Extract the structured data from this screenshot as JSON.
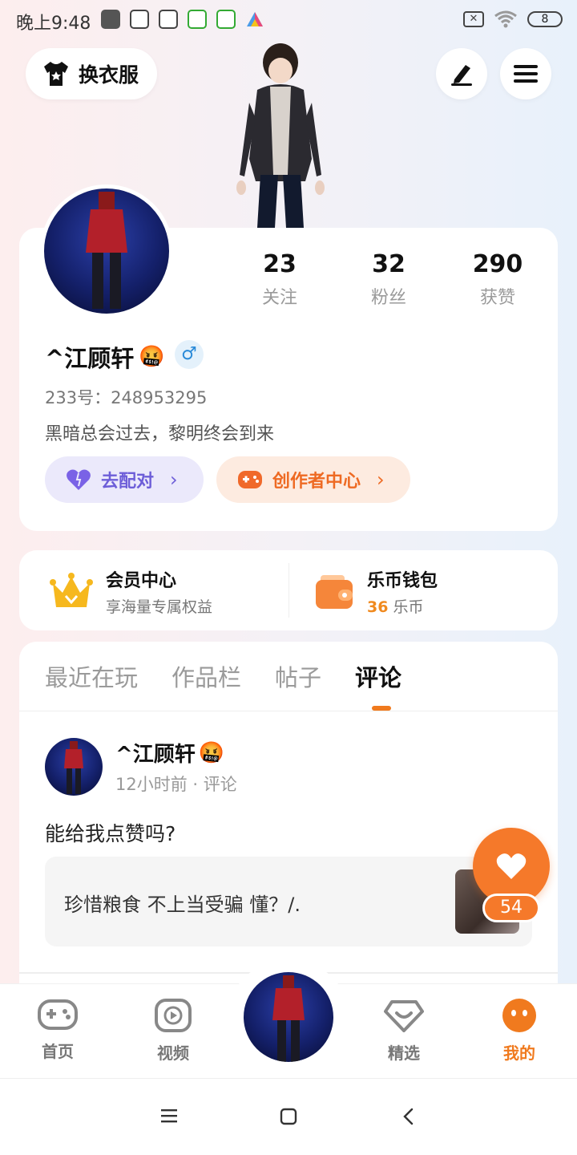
{
  "status_bar": {
    "time": "晚上9:48",
    "battery": "8"
  },
  "header": {
    "outfit_label": "换衣服",
    "edit_icon": "pen-icon",
    "menu_icon": "hamburger-icon"
  },
  "profile": {
    "name": "^江顾轩",
    "name_emoji": "🤬",
    "gender_symbol": "♂",
    "uid": "233号：248953295",
    "bio": "黑暗总会过去，黎明终会到来",
    "stats": [
      {
        "value": "23",
        "label": "关注"
      },
      {
        "value": "32",
        "label": "粉丝"
      },
      {
        "value": "290",
        "label": "获赞"
      }
    ],
    "match_label": "去配对",
    "creator_label": "创作者中心"
  },
  "member": {
    "vip_title": "会员中心",
    "vip_sub": "享海量专属权益",
    "wallet_title": "乐币钱包",
    "wallet_amount": "36",
    "wallet_unit": "乐币"
  },
  "tabs": [
    "最近在玩",
    "作品栏",
    "帖子",
    "评论"
  ],
  "active_tab": "评论",
  "post": {
    "author": "^江顾轩",
    "author_emoji": "🤬",
    "meta": "12小时前 · 评论",
    "text": "能给我点赞吗?",
    "quote": "珍惜粮食 不上当受骗 懂？/."
  },
  "like": {
    "count": "54"
  },
  "bottom_nav": [
    {
      "label": "首页",
      "icon": "gamepad-icon"
    },
    {
      "label": "视频",
      "icon": "play-icon"
    },
    {
      "label": "精选",
      "icon": "heart-badge-icon"
    },
    {
      "label": "我的",
      "icon": "face-icon"
    }
  ],
  "colors": {
    "accent": "#f07a1e",
    "match": "#6d5ed8",
    "creator": "#ee6a23",
    "gold": "#f5b21b"
  }
}
